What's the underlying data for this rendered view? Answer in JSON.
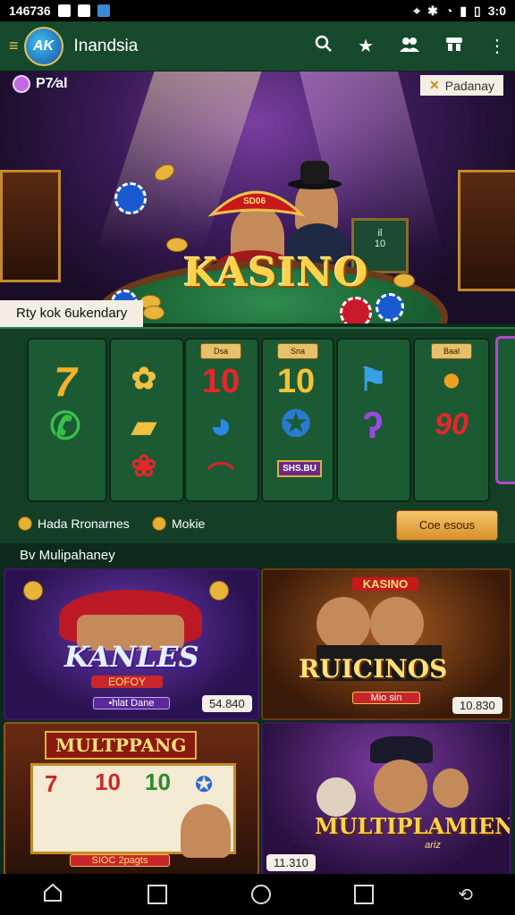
{
  "status_bar": {
    "time": "146736",
    "clock": "3:0"
  },
  "app_bar": {
    "logo_text": "AK",
    "title": "Inandsia"
  },
  "hero": {
    "label_left": "P7⁄al",
    "label_right": "Padanay",
    "title": "KASINO",
    "hat_text": "SD06",
    "board_line1": "il",
    "board_line2": "10"
  },
  "slots": {
    "section_label": "Rty kok 6ukendary",
    "reel_badges": [
      "Dsa",
      "Sna",
      "Baal"
    ],
    "symbols": [
      "7",
      "10",
      "10",
      "90"
    ],
    "tile_text": "SHS.BU",
    "legend": [
      {
        "label": "Hada Rronarnes"
      },
      {
        "label": "Mokie"
      }
    ],
    "cta_label": "Coe esous"
  },
  "cards_section": {
    "label": "Bv Mulipahaney",
    "cards": [
      {
        "title": "KANLES",
        "ribbon": "EOFOY",
        "sub": "•hlat Dane",
        "badge": "54.840"
      },
      {
        "title": "RUICINOS",
        "top": "KASINO",
        "sub": "Mio sin",
        "badge": "10.830"
      },
      {
        "title": "MULTPPANG",
        "sub": "SIOC 2pagts",
        "numbers": [
          "10",
          "10"
        ]
      },
      {
        "title": "MULTIPLAMIEN",
        "sub": "ariz",
        "badge": "11.310"
      }
    ]
  },
  "colors": {
    "accent_gold": "#ffd24a",
    "panel_green": "#143f26",
    "appbar_green": "#174a2c"
  }
}
